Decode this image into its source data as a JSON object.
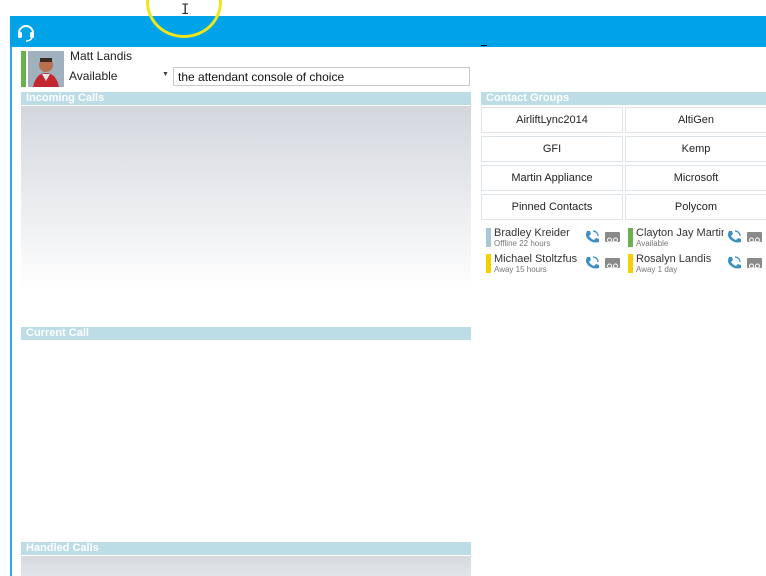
{
  "user": {
    "name": "Matt Landis",
    "status": "Available",
    "note": "the attendant console of choice",
    "presence_color": "#6ab04c"
  },
  "sections": {
    "incoming": "Incoming Calls",
    "current": "Current Call",
    "handled": "Handled Calls",
    "groups": "Contact Groups"
  },
  "groups": [
    "AirliftLync2014",
    "AltiGen",
    "GFI",
    "Kemp",
    "Martin Appliance",
    "Microsoft",
    "Pinned Contacts",
    "Polycom"
  ],
  "contacts": [
    {
      "name": "Bradley Kreider",
      "status": "Offline 22 hours",
      "color": "#a8c7d6"
    },
    {
      "name": "Clayton Jay Martin",
      "status": "Available",
      "color": "#6ab04c"
    },
    {
      "name": "Michael Stoltzfus",
      "status": "Away 15 hours",
      "color": "#f5d000"
    },
    {
      "name": "Rosalyn Landis",
      "status": "Away 1 day",
      "color": "#f5d000"
    }
  ],
  "icons": {
    "app": "headset-icon",
    "call": "phone-icon",
    "voicemail": "voicemail-icon"
  },
  "colors": {
    "topbar": "#00a2e8",
    "section_header": "#bcdce6"
  }
}
